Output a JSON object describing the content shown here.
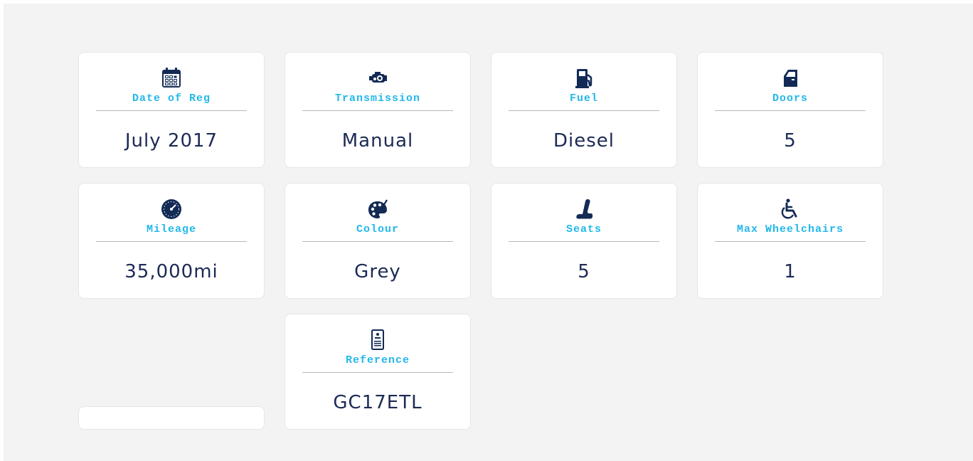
{
  "colors": {
    "accent": "#22b8ea",
    "text": "#1c2a55",
    "icon": "#132a55",
    "background": "#f3f3f3"
  },
  "specs": [
    {
      "label": "Date of Reg",
      "value": "July 2017",
      "icon": "calendar-icon"
    },
    {
      "label": "Transmission",
      "value": "Manual",
      "icon": "engine-icon"
    },
    {
      "label": "Fuel",
      "value": "Diesel",
      "icon": "fuel-pump-icon"
    },
    {
      "label": "Doors",
      "value": "5",
      "icon": "car-door-icon"
    },
    {
      "label": "Mileage",
      "value": "35,000mi",
      "icon": "speedometer-icon"
    },
    {
      "label": "Colour",
      "value": "Grey",
      "icon": "palette-icon"
    },
    {
      "label": "Seats",
      "value": "5",
      "icon": "car-seat-icon"
    },
    {
      "label": "Max Wheelchairs",
      "value": "1",
      "icon": "wheelchair-icon"
    },
    {
      "label": "Reference",
      "value": "GC17ETL",
      "icon": "document-icon"
    }
  ]
}
